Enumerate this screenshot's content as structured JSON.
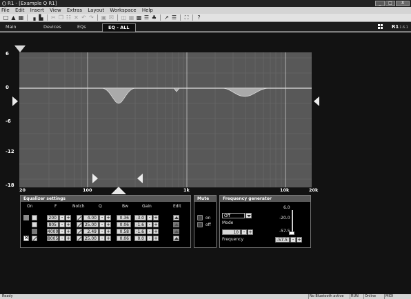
{
  "window": {
    "title": "R1 - [Example Q R1]",
    "min": "_",
    "max": "□",
    "close": "X"
  },
  "menu": [
    "File",
    "Edit",
    "Insert",
    "View",
    "Extras",
    "Layout",
    "Workspace",
    "Help"
  ],
  "toolbar_icons": [
    "new-icon",
    "open-icon",
    "save-icon",
    "chart-icon",
    "chart-stack-icon",
    "cut-icon",
    "copy-icon",
    "paste-icon",
    "delete-icon",
    "undo-icon",
    "redo-icon",
    "frame-icon",
    "frame-x-icon",
    "window-icon",
    "grid-icon",
    "layout-icon",
    "align-icon",
    "hierarchy-icon",
    "arrow-tool-icon",
    "list-icon",
    "select-icon",
    "help-icon"
  ],
  "tabs": [
    "Main",
    "Devices",
    "EQs",
    "EQ - ALL"
  ],
  "device": {
    "name": "R1",
    "version": "1.6.1"
  },
  "graph": {
    "y_labels": [
      "6",
      "0",
      "-6",
      "-12",
      "-18"
    ],
    "x_labels": [
      "20",
      "100",
      "1k",
      "10k",
      "20k"
    ]
  },
  "equalizer": {
    "title": "Equalizer settings",
    "headers": {
      "on": "On",
      "f": "F",
      "notch": "Notch",
      "q": "Q",
      "bw": "Bw",
      "gain": "Gain",
      "edit": "Edit"
    },
    "bands": [
      {
        "f": "200",
        "q": "4.00",
        "bw": "0.36",
        "gain": "-3.0",
        "on": false,
        "notch": true
      },
      {
        "f": "805",
        "q": "25.00",
        "bw": "0.06",
        "gain": "-1.6",
        "on": false,
        "notch": false
      },
      {
        "f": "4000",
        "q": "2.49",
        "bw": "0.58",
        "gain": "-1.6",
        "on": false,
        "notch": false
      },
      {
        "f": "8005",
        "q": "25.00",
        "bw": "0.06",
        "gain": "0.0",
        "on": true,
        "notch": true
      }
    ]
  },
  "mute": {
    "title": "Mute",
    "on_label": "on",
    "off_label": "off"
  },
  "generator": {
    "title": "Frequency generator",
    "mode_value": "Off",
    "mode_label": "Mode",
    "freq_value": "10",
    "freq_label": "Frequency",
    "level_max": "6.0",
    "level_mid": "-20.0",
    "level_min": "-57.5",
    "level_value": "-57.5"
  },
  "status": {
    "left": "Ready",
    "cells": [
      "No Bluetooth active",
      "RUN",
      "Online",
      "MIDI"
    ]
  }
}
